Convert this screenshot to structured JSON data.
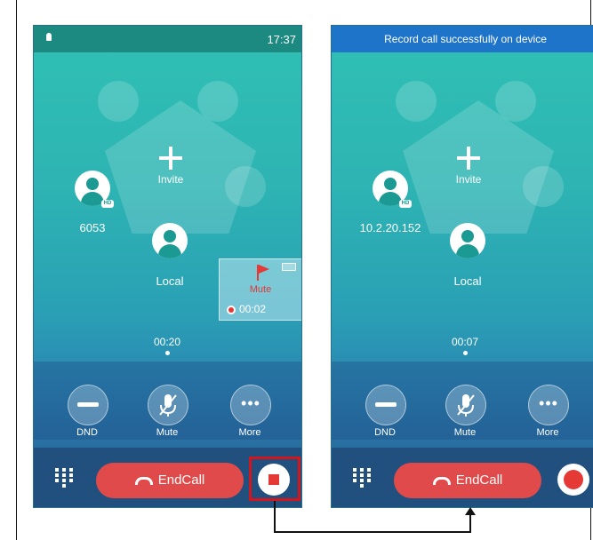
{
  "screen1": {
    "status_time": "17:37",
    "invite_label": "Invite",
    "participant_remote": "6053",
    "participant_local": "Local",
    "hd_badge": "HD",
    "mini_card_label": "Mute",
    "mini_card_timer": "00:02",
    "call_timer": "00:20",
    "controls": {
      "dnd": "DND",
      "mute": "Mute",
      "more": "More"
    },
    "end_call": "EndCall"
  },
  "screen2": {
    "banner": "Record call successfully on device",
    "invite_label": "Invite",
    "participant_remote": "10.2.20.152",
    "participant_local": "Local",
    "hd_badge": "HD",
    "call_timer": "00:07",
    "controls": {
      "dnd": "DND",
      "mute": "Mute",
      "more": "More"
    },
    "end_call": "EndCall"
  },
  "icons": {
    "lock": "lock-icon",
    "plus": "plus-icon",
    "avatar": "person-avatar-icon",
    "flag": "flag-icon",
    "battery": "battery-icon",
    "record": "record-dot-icon",
    "dnd": "minus-icon",
    "mute": "muted-mic-icon",
    "more": "ellipsis-icon",
    "keypad": "keypad-icon",
    "handset": "handset-icon",
    "stop": "stop-record-icon"
  },
  "colors": {
    "endcall": "#e14a4a",
    "record": "#e53935",
    "highlight": "#d4161c",
    "status1": "#1c8a80",
    "status2": "#1e74c8"
  }
}
